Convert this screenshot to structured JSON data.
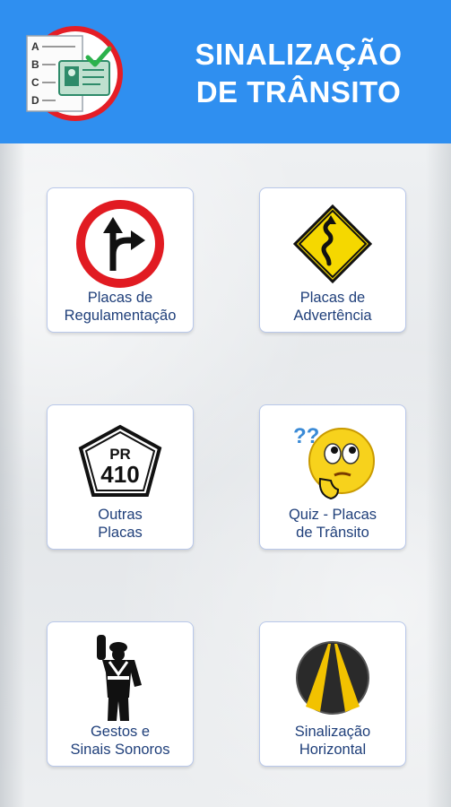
{
  "header": {
    "title_line1": "SINALIZAÇÃO",
    "title_line2": "DE TRÂNSITO",
    "logo_letters": [
      "A",
      "B",
      "C",
      "D"
    ],
    "colors": {
      "background": "#2f8ff0",
      "text": "#ffffff"
    }
  },
  "menu": {
    "items": [
      {
        "line1": "Placas de",
        "line2": "Regulamentação",
        "icon": "regulation-sign-icon"
      },
      {
        "line1": "Placas de",
        "line2": "Advertência",
        "icon": "warning-sign-icon"
      },
      {
        "line1": "Outras",
        "line2": "Placas",
        "icon": "highway-shield-icon",
        "sign_top": "PR",
        "sign_number": "410"
      },
      {
        "line1": "Quiz - Placas",
        "line2": "de Trânsito",
        "icon": "thinking-emoji-icon",
        "marks": "??"
      },
      {
        "line1": "Gestos e",
        "line2": "Sinais Sonoros",
        "icon": "traffic-officer-icon"
      },
      {
        "line1": "Sinalização",
        "line2": "Horizontal",
        "icon": "road-markings-icon"
      }
    ],
    "colors": {
      "card_border": "#b9c8ea",
      "label": "#1f3f7a"
    }
  }
}
